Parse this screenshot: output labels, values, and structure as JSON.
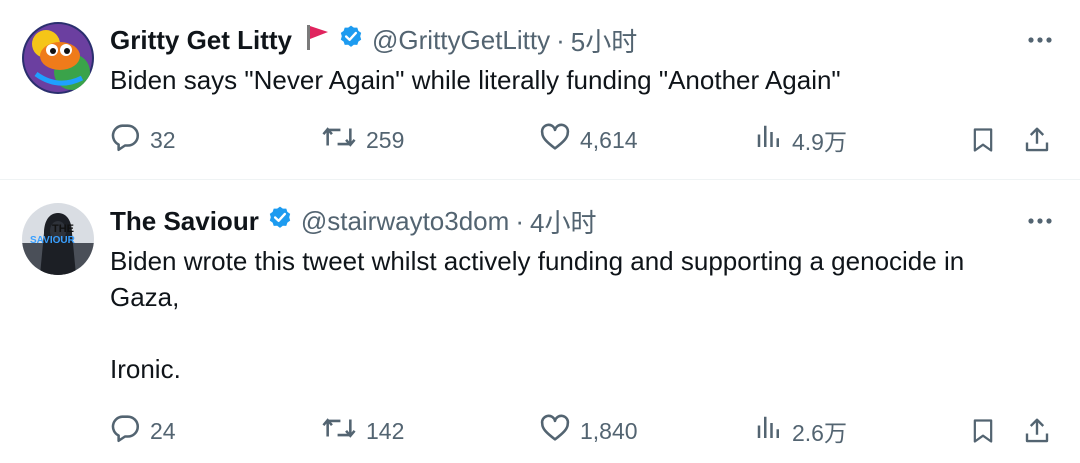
{
  "tweets": [
    {
      "display_name": "Gritty Get Litty",
      "handle": "@GrittyGetLitty",
      "separator": "·",
      "time": "5小时",
      "text_lines": [
        "Biden says \"Never Again\" while literally funding \"Another Again\""
      ],
      "replies": "32",
      "reposts": "259",
      "likes": "4,614",
      "views": "4.9万"
    },
    {
      "display_name": "The Saviour",
      "handle": "@stairwayto3dom",
      "separator": "·",
      "time": "4小时",
      "avatar_text_top": "THE",
      "avatar_text_bottom": "SAVIOUR",
      "text_lines": [
        "Biden wrote this tweet whilst actively funding and supporting a genocide in",
        "Gaza,",
        "",
        "Ironic."
      ],
      "replies": "24",
      "reposts": "142",
      "likes": "1,840",
      "views": "2.6万"
    }
  ],
  "icons": {
    "reply": "reply-icon",
    "repost": "repost-icon",
    "like": "like-icon",
    "views": "views-icon",
    "bookmark": "bookmark-icon",
    "share": "share-icon",
    "more": "more-icon",
    "verified": "verified-badge-icon",
    "flag": "red-flag-icon"
  },
  "colors": {
    "text_primary": "#0f1419",
    "text_secondary": "#536471",
    "verified_blue": "#1d9bf0",
    "flag_red": "#e0245e",
    "divider": "#eff3f4"
  }
}
